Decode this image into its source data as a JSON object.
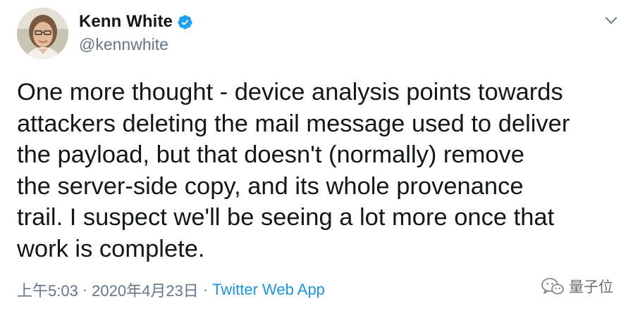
{
  "tweet": {
    "author": {
      "display_name": "Kenn White",
      "handle": "@kennwhite",
      "verified": true
    },
    "body_lines": [
      "One more thought - device analysis points towards",
      "attackers deleting the mail message used to deliver",
      "the payload, but that doesn't (normally) remove",
      "the server-side copy, and its whole provenance",
      "trail. I suspect we'll be seeing a lot more once that",
      "work is complete."
    ],
    "meta": {
      "time": "上午5:03",
      "separator": "·",
      "date": "2020年4月23日",
      "separator2": "·",
      "source": "Twitter Web App"
    }
  },
  "watermark": {
    "text": "量子位"
  },
  "colors": {
    "text_primary": "#14171a",
    "text_secondary": "#657786",
    "link": "#1b95e0",
    "verified_badge": "#1da1f2"
  }
}
